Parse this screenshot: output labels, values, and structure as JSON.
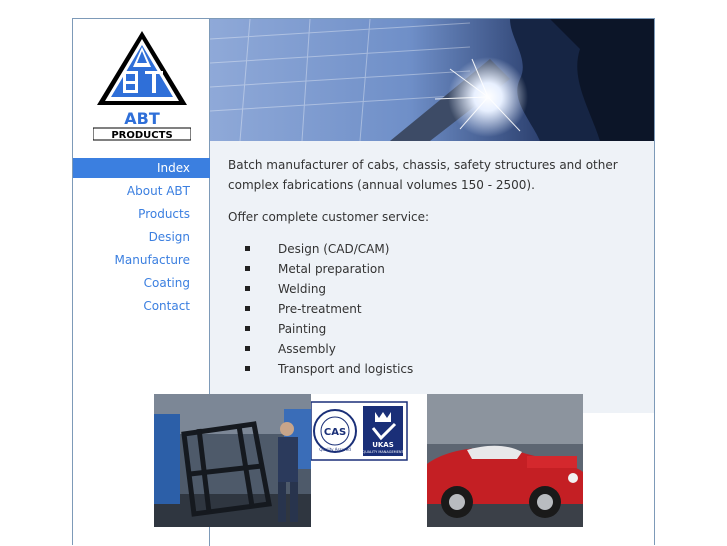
{
  "logo": {
    "letters": "ABT",
    "word1": "ABT",
    "word2": "PRODUCTS"
  },
  "nav": {
    "items": [
      {
        "label": "Index",
        "active": true
      },
      {
        "label": "About ABT",
        "active": false
      },
      {
        "label": "Products",
        "active": false
      },
      {
        "label": "Design",
        "active": false
      },
      {
        "label": "Manufacture",
        "active": false
      },
      {
        "label": "Coating",
        "active": false
      },
      {
        "label": "Contact",
        "active": false
      }
    ]
  },
  "content": {
    "intro": "Batch manufacturer of cabs, chassis, safety structures and other complex fabrications (annual volumes 150 - 2500).",
    "service_heading": "Offer complete customer service:",
    "services": [
      "Design (CAD/CAM)",
      "Metal preparation",
      "Welding",
      "Pre-treatment",
      "Painting",
      "Assembly",
      "Transport and logistics"
    ]
  },
  "certification": {
    "cas_label": "CAS",
    "cas_ring_text": "Quality Assured",
    "ukas_label": "UKAS",
    "ukas_sub": "QUALITY MANAGEMENT"
  },
  "colors": {
    "accent": "#3b7fe0",
    "border": "#7d9ab8",
    "content_bg": "#eef2f7",
    "logo_blue": "#2f6fd8"
  },
  "icons": {
    "bullet": "square-bullet-icon",
    "ukas": "crown-check-icon"
  }
}
